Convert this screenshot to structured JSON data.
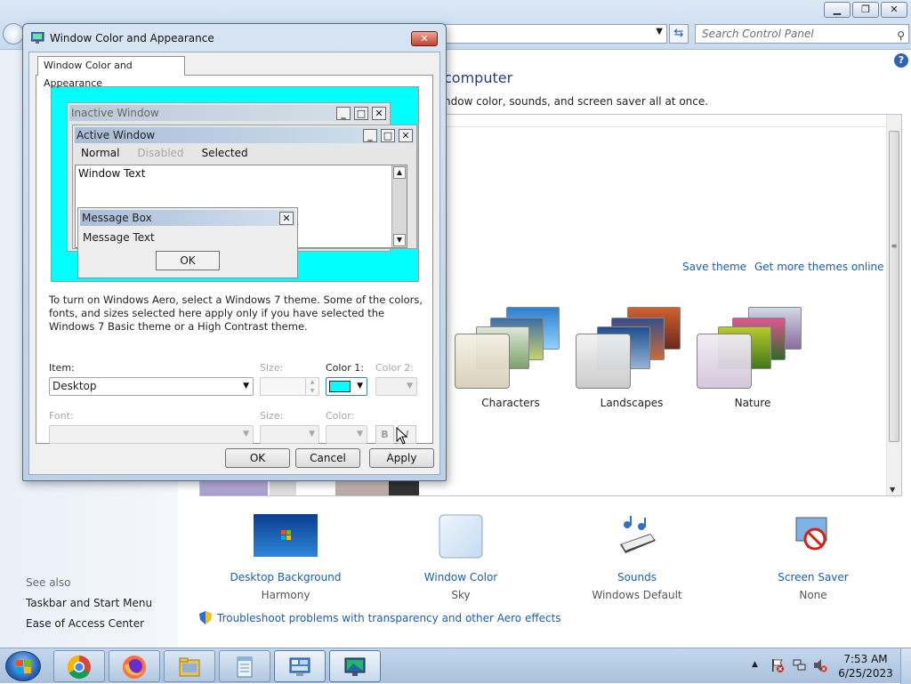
{
  "control_panel": {
    "search_placeholder": "Search Control Panel",
    "heading": "computer",
    "description": "ndow color, sounds, and screen saver all at once.",
    "save_theme": "Save theme",
    "get_more_themes": "Get more themes online",
    "themes": [
      {
        "name": "Characters"
      },
      {
        "name": "Landscapes"
      },
      {
        "name": "Nature"
      }
    ],
    "bottom_items": [
      {
        "label": "Desktop Background",
        "sub": "Harmony",
        "icon": "desktop-background-icon"
      },
      {
        "label": "Window Color",
        "sub": "Sky",
        "icon": "window-color-icon"
      },
      {
        "label": "Sounds",
        "sub": "Windows Default",
        "icon": "sounds-icon"
      },
      {
        "label": "Screen Saver",
        "sub": "None",
        "icon": "screen-saver-icon"
      }
    ],
    "troubleshoot_link": "Troubleshoot problems with transparency and other Aero effects",
    "see_also": {
      "title": "See also",
      "links": [
        "Taskbar and Start Menu",
        "Ease of Access Center"
      ]
    }
  },
  "dialog": {
    "title": "Window Color and Appearance",
    "tab": "Window Color and Appearance",
    "preview": {
      "inactive_title": "Inactive Window",
      "active_title": "Active Window",
      "menu": {
        "normal": "Normal",
        "disabled": "Disabled",
        "selected": "Selected"
      },
      "window_text": "Window Text",
      "message_box_title": "Message Box",
      "message_text": "Message Text",
      "ok": "OK",
      "background_color": "#00FFFF"
    },
    "info": "To turn on Windows Aero, select a Windows 7 theme.  Some of the colors, fonts, and sizes selected here apply only if you have selected the Windows 7 Basic theme or a High Contrast theme.",
    "item_label": "Item:",
    "item_value": "Desktop",
    "size_label": "Size:",
    "color1_label": "Color 1:",
    "color1_value": "#00FFFF",
    "color2_label": "Color 2:",
    "font_label": "Font:",
    "font_size_label": "Size:",
    "font_color_label": "Color:",
    "bold": "B",
    "italic": "I",
    "buttons": {
      "ok": "OK",
      "cancel": "Cancel",
      "apply": "Apply"
    }
  },
  "taskbar": {
    "apps": [
      "chrome",
      "firefox",
      "windows-explorer",
      "notepad",
      "control-panel",
      "display-settings"
    ],
    "clock_time": "7:53 AM",
    "clock_date": "6/25/2023"
  }
}
